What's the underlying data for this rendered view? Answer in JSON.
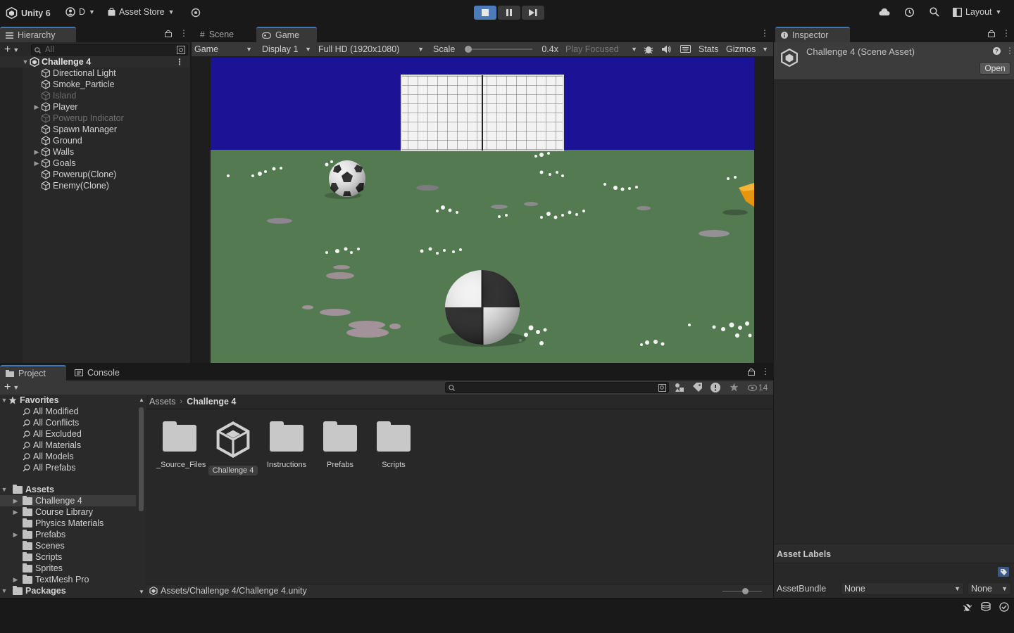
{
  "toolbar": {
    "app_name": "Unity 6",
    "account_label": "D",
    "asset_store_label": "Asset Store",
    "layout_label": "Layout"
  },
  "hierarchy": {
    "tab_label": "Hierarchy",
    "search_placeholder": "All",
    "scene_name": "Challenge 4",
    "items": [
      {
        "label": "Directional Light",
        "expandable": false,
        "dim": false
      },
      {
        "label": "Smoke_Particle",
        "expandable": false,
        "dim": false
      },
      {
        "label": "Island",
        "expandable": false,
        "dim": true
      },
      {
        "label": "Player",
        "expandable": true,
        "dim": false
      },
      {
        "label": "Powerup Indicator",
        "expandable": false,
        "dim": true
      },
      {
        "label": "Spawn Manager",
        "expandable": false,
        "dim": false
      },
      {
        "label": "Ground",
        "expandable": false,
        "dim": false
      },
      {
        "label": "Walls",
        "expandable": true,
        "dim": false
      },
      {
        "label": "Goals",
        "expandable": true,
        "dim": false
      },
      {
        "label": "Powerup(Clone)",
        "expandable": false,
        "dim": false
      },
      {
        "label": "Enemy(Clone)",
        "expandable": false,
        "dim": false
      }
    ]
  },
  "game_view": {
    "tab_scene": "Scene",
    "tab_game": "Game",
    "mode_label": "Game",
    "display_label": "Display 1",
    "resolution_label": "Full HD (1920x1080)",
    "scale_label": "Scale",
    "scale_value": "0.4x",
    "scale_fraction": 0.0,
    "play_mode_label": "Play Focused",
    "stats_label": "Stats",
    "gizmos_label": "Gizmos",
    "colors": {
      "sky": "#1b1296",
      "ground": "#547a51"
    }
  },
  "inspector": {
    "tab_label": "Inspector",
    "title": "Challenge 4 (Scene Asset)",
    "open_button": "Open",
    "asset_labels_title": "Asset Labels",
    "assetbundle_label": "AssetBundle",
    "assetbundle_value": "None",
    "assetbundle_variant": "None"
  },
  "project": {
    "tab_project": "Project",
    "tab_console": "Console",
    "hidden_count": "14",
    "favorites_label": "Favorites",
    "favorites": [
      "All Modified",
      "All Conflicts",
      "All Excluded",
      "All Materials",
      "All Models",
      "All Prefabs"
    ],
    "assets_label": "Assets",
    "asset_folders": [
      {
        "label": "Challenge 4",
        "expandable": true,
        "selected": true
      },
      {
        "label": "Course Library",
        "expandable": true,
        "selected": false
      },
      {
        "label": "Physics Materials",
        "expandable": false,
        "selected": false
      },
      {
        "label": "Prefabs",
        "expandable": true,
        "selected": false
      },
      {
        "label": "Scenes",
        "expandable": false,
        "selected": false
      },
      {
        "label": "Scripts",
        "expandable": false,
        "selected": false
      },
      {
        "label": "Sprites",
        "expandable": false,
        "selected": false
      },
      {
        "label": "TextMesh Pro",
        "expandable": true,
        "selected": false
      }
    ],
    "packages_label": "Packages",
    "breadcrumb": [
      "Assets",
      "Challenge 4"
    ],
    "tiles": [
      {
        "label": "_Source_Files",
        "kind": "folder"
      },
      {
        "label": "Challenge 4",
        "kind": "unity-scene",
        "selected": true
      },
      {
        "label": "Instructions",
        "kind": "folder"
      },
      {
        "label": "Prefabs",
        "kind": "folder"
      },
      {
        "label": "Scripts",
        "kind": "folder"
      }
    ],
    "status_path": "Assets/Challenge 4/Challenge 4.unity"
  },
  "accent_color": "#3a79bb"
}
